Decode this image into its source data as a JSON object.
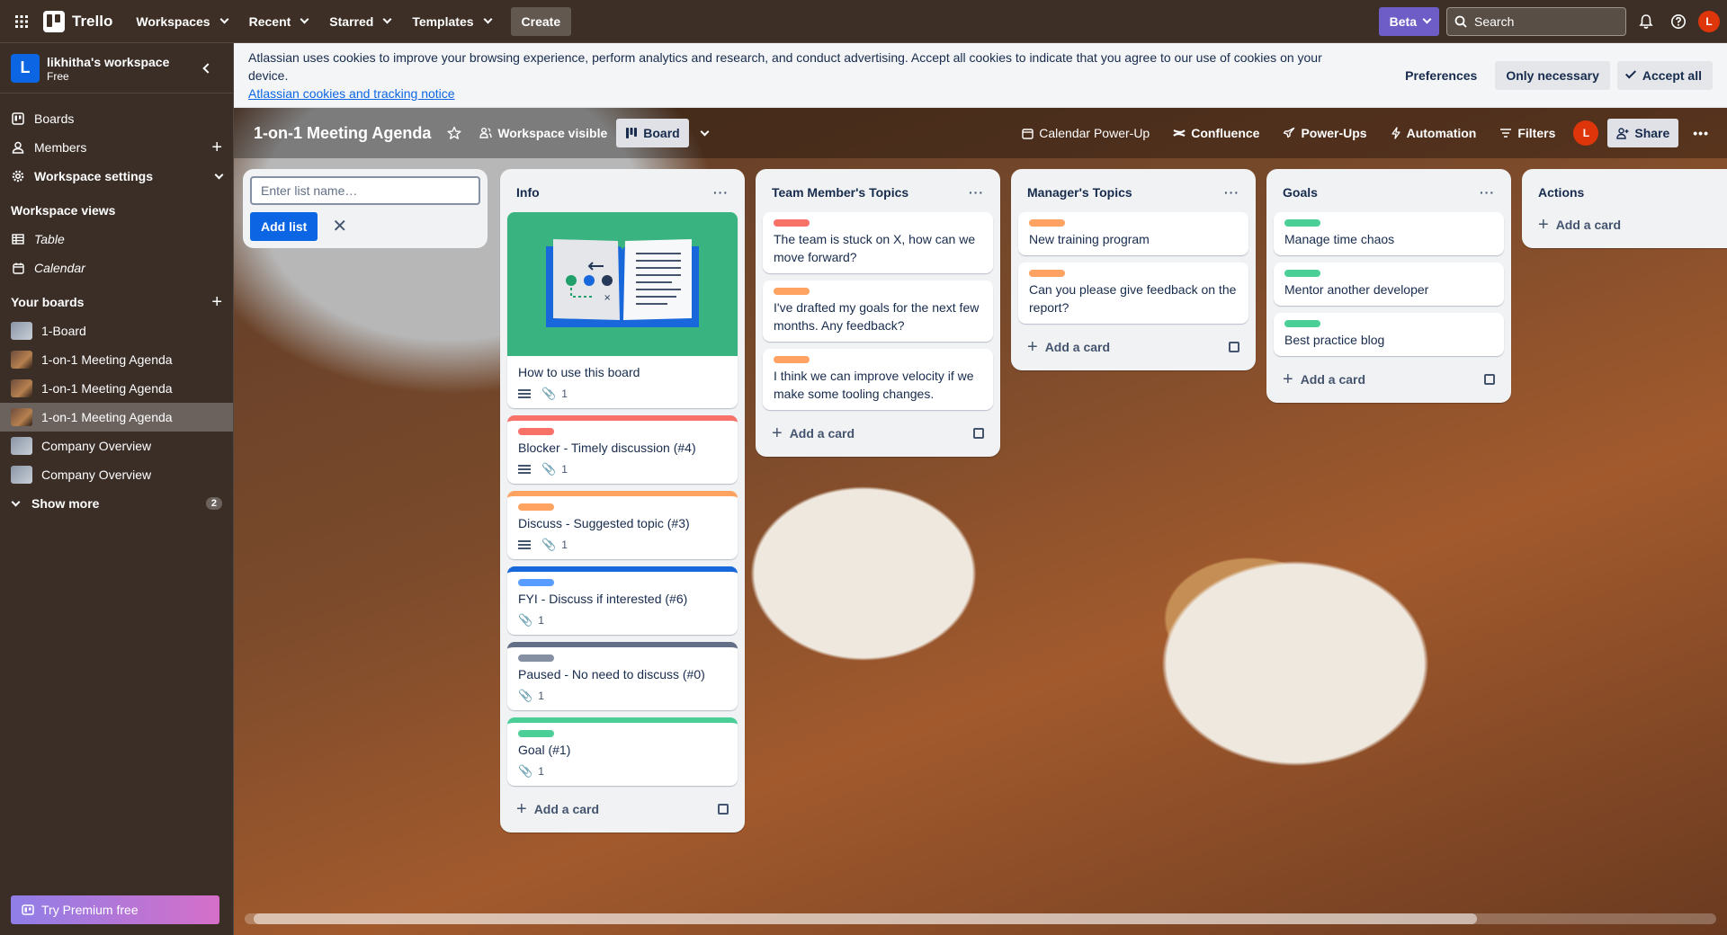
{
  "topbar": {
    "app_name": "Trello",
    "menu": [
      "Workspaces",
      "Recent",
      "Starred",
      "Templates"
    ],
    "create_label": "Create",
    "beta_label": "Beta",
    "search_placeholder": "Search",
    "avatar_initial": "L"
  },
  "sidebar": {
    "workspace_initial": "L",
    "workspace_name": "likhitha's workspace",
    "workspace_plan": "Free",
    "nav": {
      "boards": "Boards",
      "members": "Members",
      "settings": "Workspace settings"
    },
    "views_title": "Workspace views",
    "views": [
      "Table",
      "Calendar"
    ],
    "your_boards_title": "Your boards",
    "boards": [
      {
        "name": "1-Board",
        "thumb": "grey"
      },
      {
        "name": "1-on-1 Meeting Agenda",
        "thumb": "coffee"
      },
      {
        "name": "1-on-1 Meeting Agenda",
        "thumb": "coffee"
      },
      {
        "name": "1-on-1 Meeting Agenda",
        "thumb": "coffee",
        "active": true
      },
      {
        "name": "Company Overview",
        "thumb": "grey"
      },
      {
        "name": "Company Overview",
        "thumb": "grey"
      }
    ],
    "show_more": "Show more",
    "show_more_count": "2",
    "premium": "Try Premium free"
  },
  "cookie": {
    "text": "Atlassian uses cookies to improve your browsing experience, perform analytics and research, and conduct advertising. Accept all cookies to indicate that you agree to our use of cookies on your device.",
    "link": "Atlassian cookies and tracking notice",
    "preferences": "Preferences",
    "only_necessary": "Only necessary",
    "accept_all": "Accept all"
  },
  "board": {
    "title": "1-on-1 Meeting Agenda",
    "visibility": "Workspace visible",
    "view": "Board",
    "calendar_powerup": "Calendar Power-Up",
    "confluence": "Confluence",
    "powerups": "Power-Ups",
    "automation": "Automation",
    "filters": "Filters",
    "share": "Share",
    "avatar_initial": "L"
  },
  "new_list": {
    "placeholder": "Enter list name…",
    "add_label": "Add list"
  },
  "add_card_label": "Add a card",
  "lists": {
    "info": {
      "title": "Info",
      "cards": [
        {
          "title": "How to use this board",
          "attachments": "1",
          "cover": true
        },
        {
          "title": "Blocker - Timely discussion (#4)",
          "attachments": "1",
          "color": "#f87168"
        },
        {
          "title": "Discuss - Suggested topic (#3)",
          "attachments": "1",
          "color": "#fea362"
        },
        {
          "title": "FYI - Discuss if interested (#6)",
          "attachments": "1",
          "color": "#579dff"
        },
        {
          "title": "Paused - No need to discuss (#0)",
          "attachments": "1",
          "color": "#8590a2"
        },
        {
          "title": "Goal (#1)",
          "attachments": "1",
          "color": "#4bce97"
        }
      ]
    },
    "team": {
      "title": "Team Member's Topics",
      "cards": [
        {
          "title": "The team is stuck on X, how can we move forward?",
          "color": "#f87168"
        },
        {
          "title": "I've drafted my goals for the next few months. Any feedback?",
          "color": "#fea362"
        },
        {
          "title": "I think we can improve velocity if we make some tooling changes.",
          "color": "#fea362"
        }
      ]
    },
    "manager": {
      "title": "Manager's Topics",
      "cards": [
        {
          "title": "New training program",
          "color": "#fea362"
        },
        {
          "title": "Can you please give feedback on the report?",
          "color": "#fea362"
        }
      ]
    },
    "goals": {
      "title": "Goals",
      "cards": [
        {
          "title": "Manage time chaos",
          "color": "#4bce97"
        },
        {
          "title": "Mentor another developer",
          "color": "#4bce97"
        },
        {
          "title": "Best practice blog",
          "color": "#4bce97"
        }
      ]
    },
    "actions": {
      "title": "Actions",
      "cards": []
    }
  }
}
